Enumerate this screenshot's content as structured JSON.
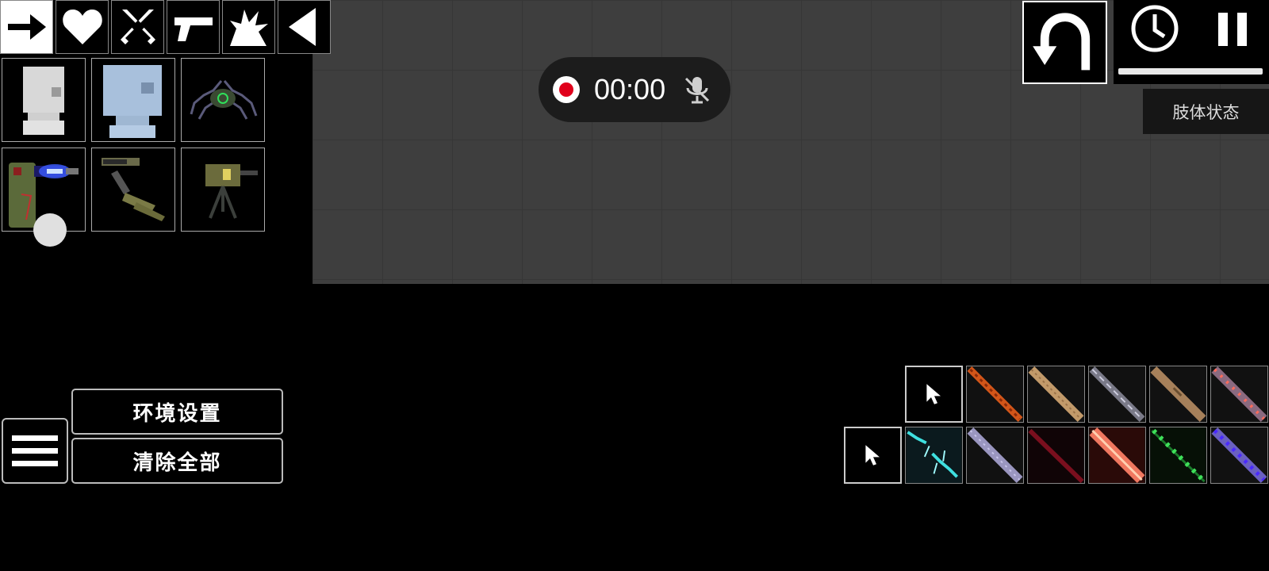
{
  "categories": [
    {
      "name": "arrow-icon",
      "active": true
    },
    {
      "name": "heart-icon",
      "active": false
    },
    {
      "name": "crossed-swords-icon",
      "active": false
    },
    {
      "name": "pistol-icon",
      "active": false
    },
    {
      "name": "explosion-icon",
      "active": false
    },
    {
      "name": "collapse-left-icon",
      "active": false
    }
  ],
  "items": [
    {
      "name": "white-block-item"
    },
    {
      "name": "ice-block-item"
    },
    {
      "name": "spider-bot-item"
    },
    {
      "name": "laser-turret-item"
    },
    {
      "name": "mounted-gun-item"
    },
    {
      "name": "tripod-turret-item"
    }
  ],
  "recorder": {
    "time": "00:00",
    "record_icon": "record-icon",
    "mic_icon": "mic-muted-icon"
  },
  "controls": {
    "undo_icon": "undo-icon",
    "clock_icon": "clock-icon",
    "pause_icon": "pause-icon",
    "time_scale": 1.0
  },
  "limb_status_label": "肢体状态",
  "buttons": {
    "environment": "环境设置",
    "clear_all": "清除全部",
    "menu_icon": "hamburger-menu-icon"
  },
  "tool_rows": [
    [
      "select-cursor",
      "fire-rod",
      "wood-rod",
      "steel-rod",
      "bronze-rod",
      "rose-rod"
    ],
    [
      "select-cursor",
      "ice-shard-rod",
      "lilac-rod",
      "blood-rod",
      "heat-rod",
      "green-arrow-rod",
      "violet-arrow-rod"
    ]
  ],
  "colors": {
    "sandbox": "#3e3e3e",
    "record": "#e0001b",
    "laser": "#3b5bff"
  }
}
